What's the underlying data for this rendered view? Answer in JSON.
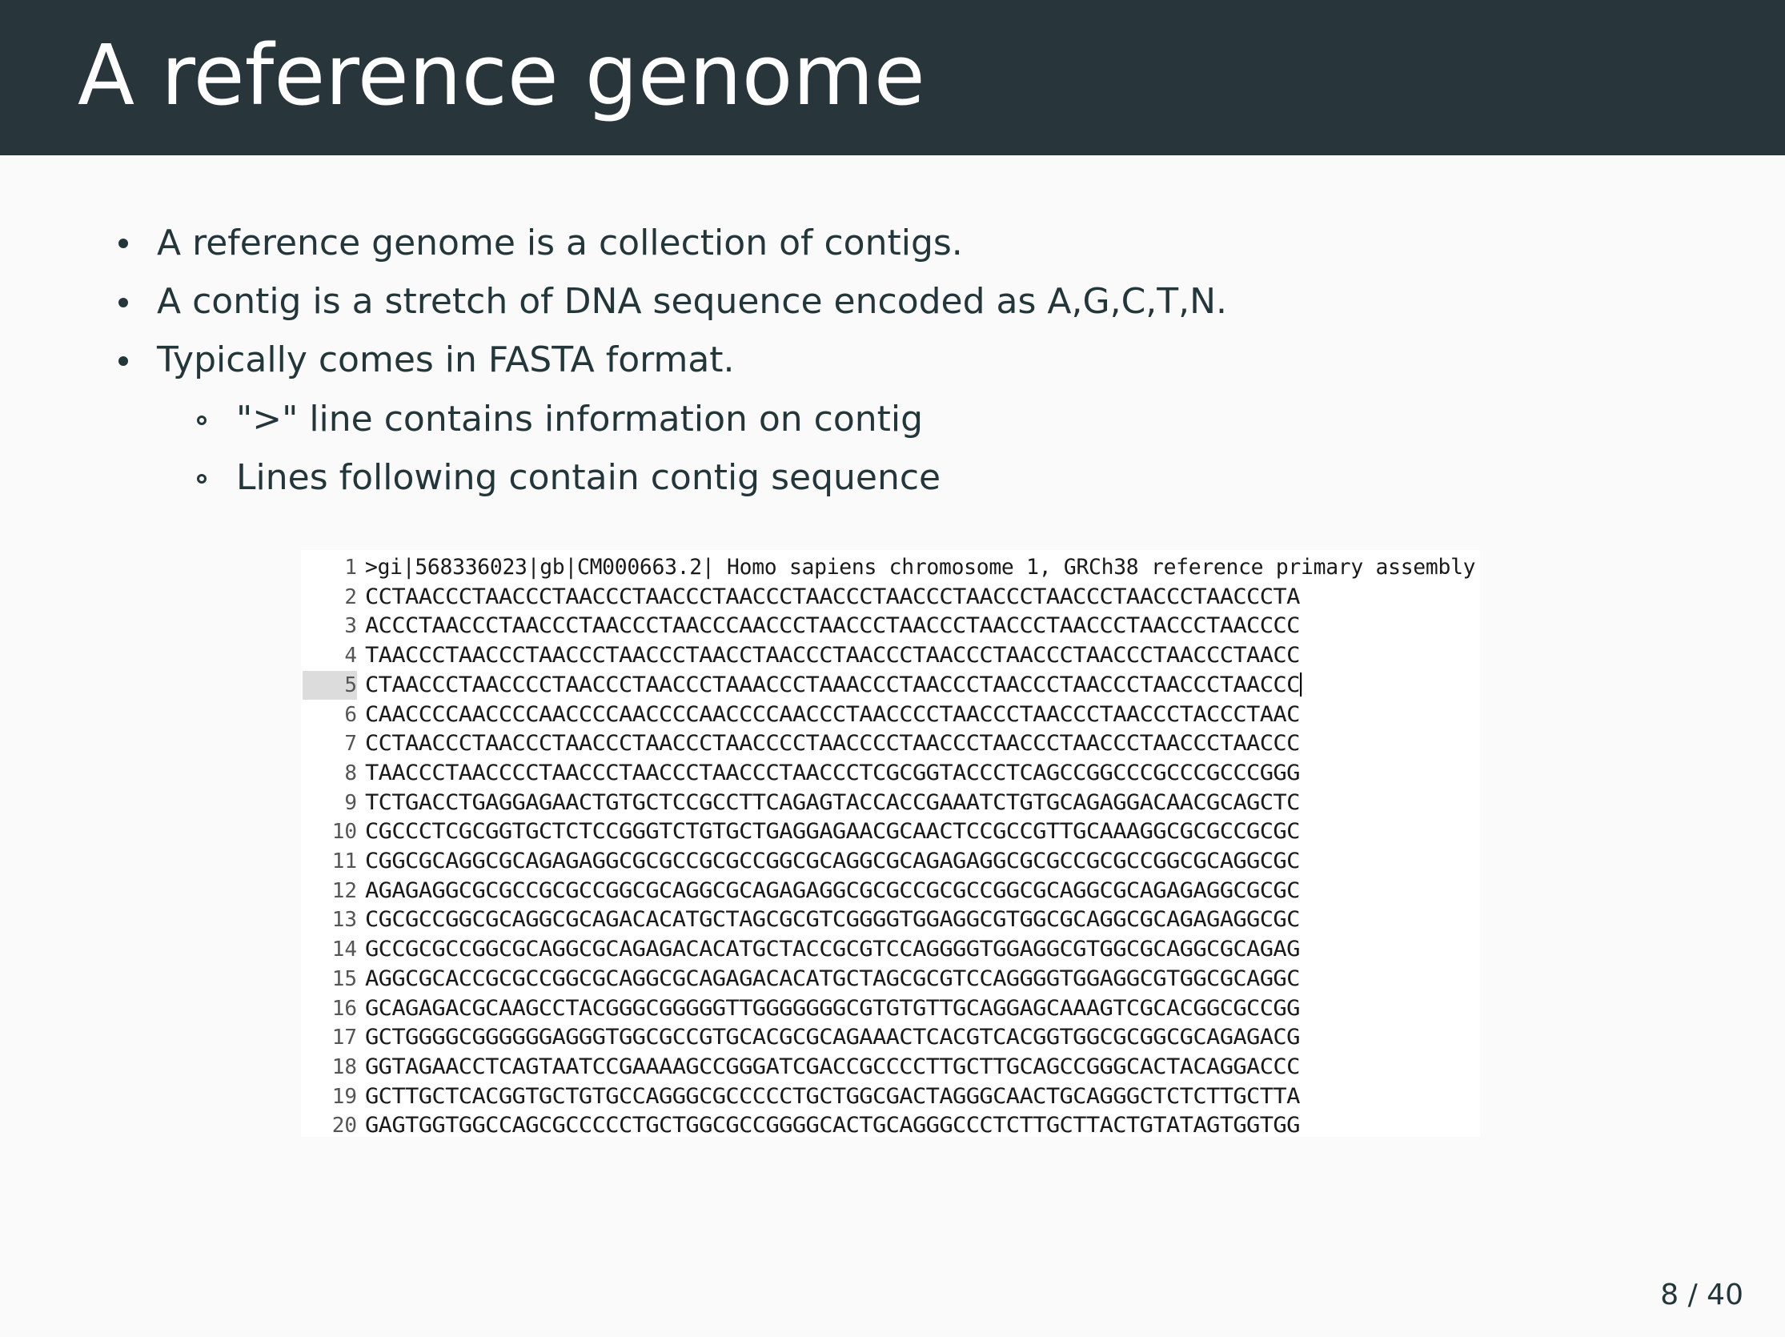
{
  "slide": {
    "title": "A reference genome",
    "page_number": "8 / 40"
  },
  "bullets": [
    {
      "level": 1,
      "text": "A reference genome is a collection of contigs."
    },
    {
      "level": 1,
      "text": "A contig is a stretch of DNA sequence encoded as A,G,C,T,N."
    },
    {
      "level": 1,
      "text": "Typically comes in FASTA format."
    },
    {
      "level": 2,
      "text": "\">\" line contains information on contig"
    },
    {
      "level": 2,
      "text": "Lines following contain contig sequence"
    }
  ],
  "fasta": {
    "active_line": 5,
    "lines": [
      {
        "num": "1",
        "text": ">gi|568336023|gb|CM000663.2| Homo sapiens chromosome 1, GRCh38 reference primary assembly"
      },
      {
        "num": "2",
        "text": "CCTAACCCTAACCCTAACCCTAACCCTAACCCTAACCCTAACCCTAACCCTAACCCTAACCCTAACCCTA"
      },
      {
        "num": "3",
        "text": "ACCCTAACCCTAACCCTAACCCTAACCCAACCCTAACCCTAACCCTAACCCTAACCCTAACCCTAACCCC"
      },
      {
        "num": "4",
        "text": "TAACCCTAACCCTAACCCTAACCCTAACCTAACCCTAACCCTAACCCTAACCCTAACCCTAACCCTAACC"
      },
      {
        "num": "5",
        "text": "CTAACCCTAACCCCTAACCCTAACCCTAAACCCTAAACCCTAACCCTAACCCTAACCCTAACCCTAACCC"
      },
      {
        "num": "6",
        "text": "CAACCCCAACCCCAACCCCAACCCCAACCCCAACCCTAACCCCTAACCCTAACCCTAACCCTACCCTAAC"
      },
      {
        "num": "7",
        "text": "CCTAACCCTAACCCTAACCCTAACCCTAACCCCTAACCCCTAACCCTAACCCTAACCCTAACCCTAACCC"
      },
      {
        "num": "8",
        "text": "TAACCCTAACCCCTAACCCTAACCCTAACCCTAACCCTCGCGGTACCCTCAGCCGGCCCGCCCGCCCGGG"
      },
      {
        "num": "9",
        "text": "TCTGACCTGAGGAGAACTGTGCTCCGCCTTCAGAGTACCACCGAAATCTGTGCAGAGGACAACGCAGCTC"
      },
      {
        "num": "10",
        "text": "CGCCCTCGCGGTGCTCTCCGGGTCTGTGCTGAGGAGAACGCAACTCCGCCGTTGCAAAGGCGCGCCGCGC"
      },
      {
        "num": "11",
        "text": "CGGCGCAGGCGCAGAGAGGCGCGCCGCGCCGGCGCAGGCGCAGAGAGGCGCGCCGCGCCGGCGCAGGCGC"
      },
      {
        "num": "12",
        "text": "AGAGAGGCGCGCCGCGCCGGCGCAGGCGCAGAGAGGCGCGCCGCGCCGGCGCAGGCGCAGAGAGGCGCGC"
      },
      {
        "num": "13",
        "text": "CGCGCCGGCGCAGGCGCAGACACATGCTAGCGCGTCGGGGTGGAGGCGTGGCGCAGGCGCAGAGAGGCGC"
      },
      {
        "num": "14",
        "text": "GCCGCGCCGGCGCAGGCGCAGAGACACATGCTACCGCGTCCAGGGGTGGAGGCGTGGCGCAGGCGCAGAG"
      },
      {
        "num": "15",
        "text": "AGGCGCACCGCGCCGGCGCAGGCGCAGAGACACATGCTAGCGCGTCCAGGGGTGGAGGCGTGGCGCAGGC"
      },
      {
        "num": "16",
        "text": "GCAGAGACGCAAGCCTACGGGCGGGGGTTGGGGGGGCGTGTGTTGCAGGAGCAAAGTCGCACGGCGCCGG"
      },
      {
        "num": "17",
        "text": "GCTGGGGCGGGGGGAGGGTGGCGCCGTGCACGCGCAGAAACTCACGTCACGGTGGCGCGGCGCAGAGACG"
      },
      {
        "num": "18",
        "text": "GGTAGAACCTCAGTAATCCGAAAAGCCGGGATCGACCGCCCCTTGCTTGCAGCCGGGCACTACAGGACCC"
      },
      {
        "num": "19",
        "text": "GCTTGCTCACGGTGCTGTGCCAGGGCGCCCCCTGCTGGCGACTAGGGCAACTGCAGGGCTCTCTTGCTTA"
      },
      {
        "num": "20",
        "text": "GAGTGGTGGCCAGCGCCCCCTGCTGGCGCCGGGGCACTGCAGGGCCCTCTTGCTTACTGTATAGTGGTGG"
      }
    ]
  }
}
